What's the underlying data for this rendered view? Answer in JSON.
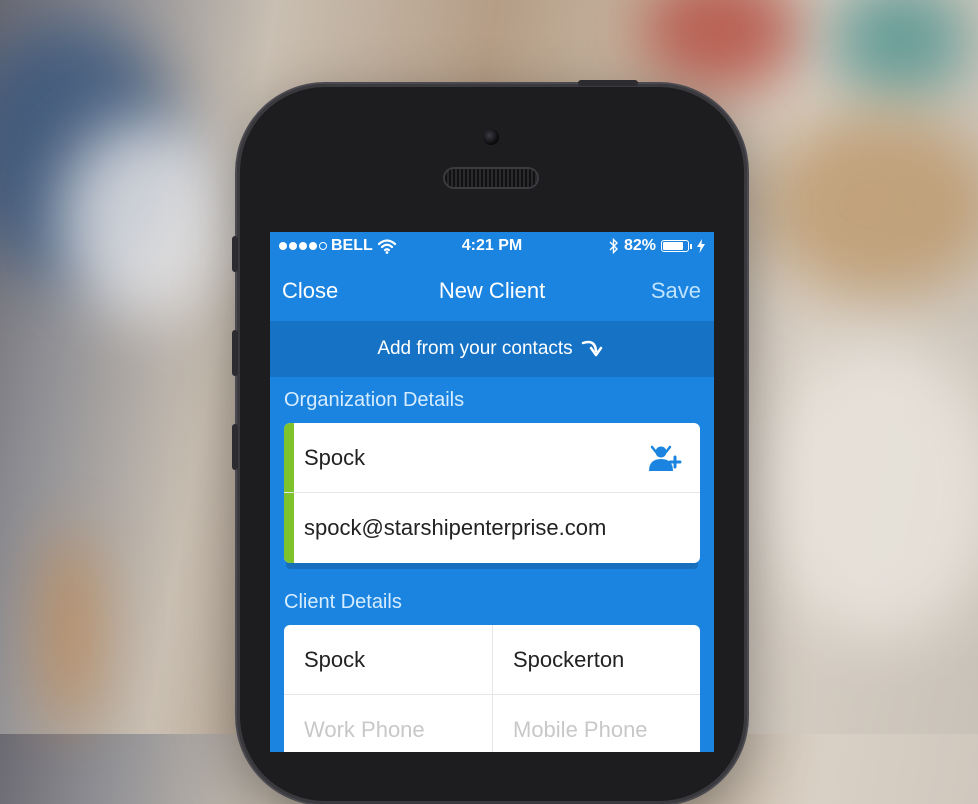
{
  "status_bar": {
    "carrier": "BELL",
    "time": "4:21 PM",
    "battery_percent": "82%",
    "battery_level": 0.82,
    "icons": [
      "signal-dots",
      "wifi-icon",
      "bluetooth-icon",
      "battery-icon",
      "charging-icon"
    ]
  },
  "nav": {
    "close_label": "Close",
    "title": "New Client",
    "save_label": "Save"
  },
  "add_contacts": {
    "label": "Add from your contacts",
    "icon": "curved-arrow-down-icon"
  },
  "organization": {
    "section_label": "Organization Details",
    "name_value": "Spock",
    "email_value": "spock@starshipenterprise.com",
    "accent_color": "#7ec22c"
  },
  "client": {
    "section_label": "Client Details",
    "first_name_value": "Spock",
    "last_name_value": "Spockerton",
    "work_phone_placeholder": "Work Phone",
    "mobile_phone_placeholder": "Mobile Phone"
  },
  "colors": {
    "screen_blue": "#1a84e0",
    "banner_blue": "#1572c5",
    "save_color": "#bfe3ff"
  }
}
